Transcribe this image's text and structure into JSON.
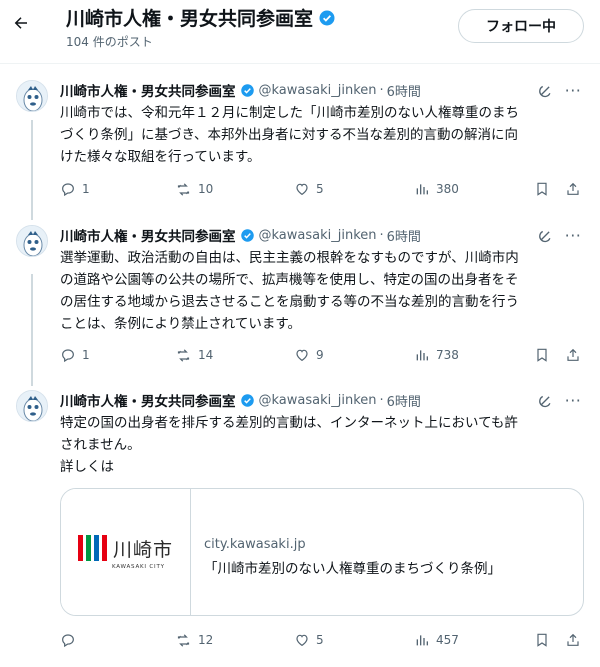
{
  "header": {
    "title": "川崎市人権・男女共同参画室",
    "post_count": "104 件のポスト",
    "follow_label": "フォロー中"
  },
  "tweets": [
    {
      "name": "川崎市人権・男女共同参画室",
      "handle": "@kawasaki_jinken",
      "time": "6時間",
      "text": "川崎市では、令和元年１２月に制定した「川崎市差別のない人権尊重のまち\nづくり条例」に基づき、本邦外出身者に対する不当な差別的言動の解消に向\nけた様々な取組を行っています。",
      "replies": "1",
      "reposts": "10",
      "likes": "5",
      "views": "380"
    },
    {
      "name": "川崎市人権・男女共同参画室",
      "handle": "@kawasaki_jinken",
      "time": "6時間",
      "text": "選挙運動、政治活動の自由は、民主主義の根幹をなすものですが、川崎市内\nの道路や公園等の公共の場所で、拡声機等を使用し、特定の国の出身者をそ\nの居住する地域から退去させることを扇動する等の不当な差別的言動を行う\nことは、条例により禁止されています。",
      "replies": "1",
      "reposts": "14",
      "likes": "9",
      "views": "738"
    },
    {
      "name": "川崎市人権・男女共同参画室",
      "handle": "@kawasaki_jinken",
      "time": "6時間",
      "text": "特定の国の出身者を排斥する差別的言動は、インターネット上においても許\nされません。\n詳しくは",
      "card": {
        "logo_text": "川崎市",
        "logo_sub": "KAWASAKI CITY",
        "domain": "city.kawasaki.jp",
        "title": "「川崎市差別のない人権尊重のまちづくり条例」"
      },
      "replies": "",
      "reposts": "12",
      "likes": "5",
      "views": "457"
    }
  ],
  "colors": {
    "verified": "#1d9bf0",
    "logo_bars": [
      "#e60012",
      "#009944",
      "#0068b7",
      "#e60012"
    ]
  },
  "icons": {
    "back": "arrow-left-icon",
    "verified": "verified-badge-icon",
    "grok": "grok-icon",
    "more": "more-icon",
    "reply": "reply-icon",
    "repost": "repost-icon",
    "like": "heart-icon",
    "views": "views-icon",
    "bookmark": "bookmark-icon",
    "share": "share-icon"
  }
}
